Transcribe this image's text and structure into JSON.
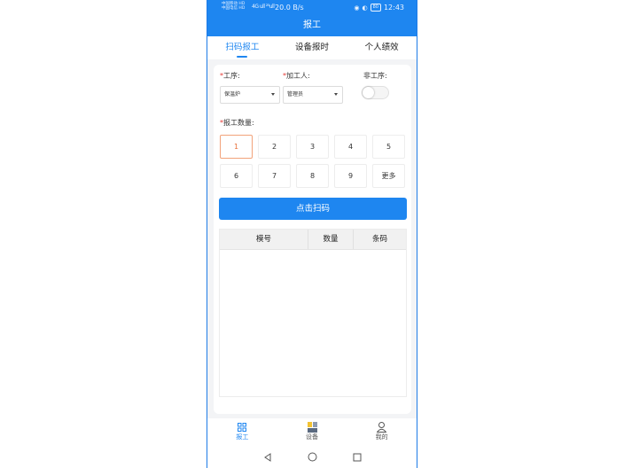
{
  "status_bar": {
    "carrier_line1": "中国移动 HD",
    "carrier_line2": "中国电信 HD",
    "signal": "4G ull ²⁵ull",
    "speed": "20.0 B/s",
    "battery": "80",
    "time": "12:43"
  },
  "header": {
    "title": "报工"
  },
  "tabs": [
    {
      "label": "扫码报工",
      "active": true
    },
    {
      "label": "设备报时",
      "active": false
    },
    {
      "label": "个人绩效",
      "active": false
    }
  ],
  "form": {
    "process": {
      "required_mark": "*",
      "label": "工序:",
      "value": "保温炉"
    },
    "worker": {
      "required_mark": "*",
      "label": "加工人:",
      "value": "管理员"
    },
    "non_process": {
      "label": "非工序:",
      "enabled": false
    },
    "quantity": {
      "required_mark": "*",
      "label": "报工数量:",
      "options": [
        "1",
        "2",
        "3",
        "4",
        "5",
        "6",
        "7",
        "8",
        "9",
        "更多"
      ],
      "selected": "1"
    }
  },
  "scan_button": {
    "label": "点击扫码"
  },
  "table": {
    "columns": [
      "模号",
      "数量",
      "条码"
    ],
    "rows": []
  },
  "bottom_nav": [
    {
      "label": "报工",
      "icon": "grid-icon",
      "active": true
    },
    {
      "label": "设备",
      "icon": "device-icon",
      "active": false
    },
    {
      "label": "我的",
      "icon": "user-icon",
      "active": false
    }
  ],
  "colors": {
    "primary": "#1e86f0",
    "selected_accent": "#e8703a",
    "required": "#e53935"
  }
}
